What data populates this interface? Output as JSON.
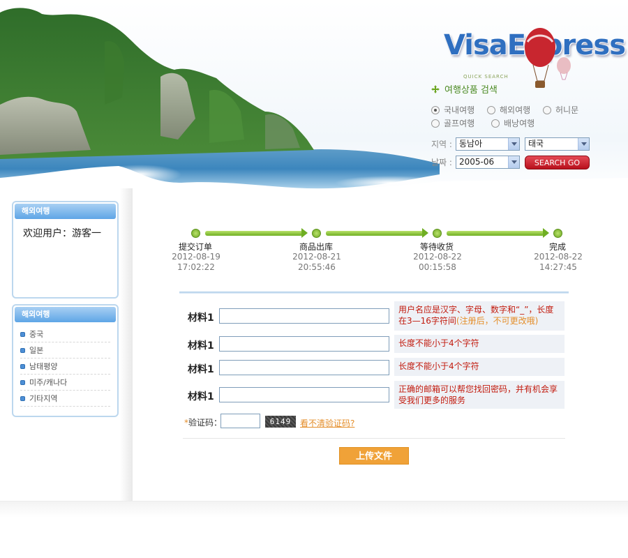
{
  "header": {
    "logo_text": "VisaExpress",
    "quick_search": "QUICK SEARCH",
    "search_title": "여행상품 검색",
    "radios": [
      {
        "label": "국내여행",
        "checked": true
      },
      {
        "label": "해외여행",
        "checked": false
      },
      {
        "label": "허니문",
        "checked": false
      },
      {
        "label": "골프여행",
        "checked": false
      },
      {
        "label": "배낭여행",
        "checked": false
      }
    ],
    "region_label": "지역 :",
    "region_value": "동남아",
    "country_value": "태국",
    "date_label": "날짜 :",
    "date_value": "2005-06",
    "search_button": "SEARCH GO"
  },
  "sidebar": {
    "box1_title": "해외여행",
    "welcome": "欢迎用户：游客一",
    "box2_title": "해외여행",
    "menu": [
      "중국",
      "일본",
      "남태평양",
      "미주/캐나다",
      "기타지역"
    ]
  },
  "steps": [
    {
      "label": "提交订单",
      "date": "2012-08-19",
      "time": "17:02:22"
    },
    {
      "label": "商品出库",
      "date": "2012-08-21",
      "time": "20:55:46"
    },
    {
      "label": "等待收货",
      "date": "2012-08-22",
      "time": "00:15:58"
    },
    {
      "label": "完成",
      "date": "2012-08-22",
      "time": "14:27:45"
    }
  ],
  "form": {
    "rows": [
      {
        "label": "材料1",
        "hint_main": "用户名应是汉字、字母、数字和“_”，长度在3—16字符间",
        "hint_note": "(注册后，不可更改哦)"
      },
      {
        "label": "材料1",
        "hint_main": "长度不能小于4个字符",
        "hint_note": ""
      },
      {
        "label": "材料1",
        "hint_main": "长度不能小于4个字符",
        "hint_note": ""
      },
      {
        "label": "材料1",
        "hint_main": "正确的邮箱可以帮您找回密码，并有机会享受我们更多的服务",
        "hint_note": ""
      }
    ],
    "captcha_star": "*",
    "captcha_label": "验证码：",
    "captcha_code": "6149",
    "captcha_link": "看不清验证码?",
    "upload_button": "上传文件"
  },
  "colors": {
    "accent_green": "#6ca621",
    "hint_red": "#c21b0e",
    "upload_orange": "#f0a238",
    "search_red": "#c41a26",
    "sidebar_blue": "#5ea5e6"
  }
}
